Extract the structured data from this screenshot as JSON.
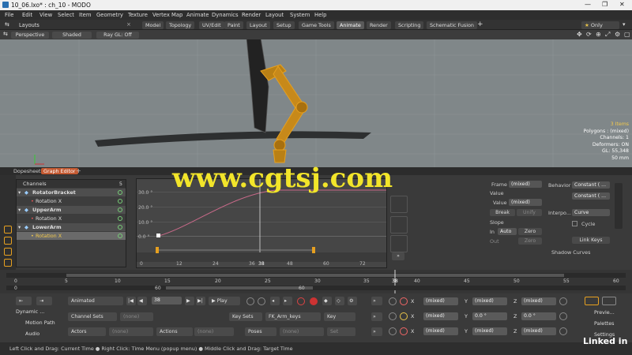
{
  "window": {
    "title": "10_06.lxo* : ch_10 - MODO"
  },
  "menu": [
    "File",
    "Edit",
    "View",
    "Select",
    "Item",
    "Geometry",
    "Texture",
    "Vertex Map",
    "Animate",
    "Dynamics",
    "Render",
    "Layout",
    "System",
    "Help"
  ],
  "layout_label": "Layouts",
  "tabs": [
    "Model",
    "Topology",
    "UV/Edit",
    "Paint",
    "Layout",
    "Setup",
    "Game Tools",
    "Animate",
    "Render",
    "Scripting",
    "Schematic Fusion"
  ],
  "active_tab": "Animate",
  "only_label": "Only",
  "viewport": {
    "view": "Perspective",
    "shading": "Shaded",
    "renderer": "Ray GL: Off"
  },
  "vp_info": [
    "3 Items",
    "Polygons : (mixed)",
    "Channels: 1",
    "Deformers: ON",
    "GL: 55,348",
    "50 mm"
  ],
  "graph_tabs": [
    "Dopesheet",
    "Graph Editor"
  ],
  "channels": {
    "header": "Channels",
    "count": "5",
    "rows": [
      {
        "name": "RotatorBracket",
        "type": "item"
      },
      {
        "name": "Rotation X",
        "type": "channel"
      },
      {
        "name": "UpperArm",
        "type": "item"
      },
      {
        "name": "Rotation X",
        "type": "channel"
      },
      {
        "name": "LowerArm",
        "type": "item"
      },
      {
        "name": "Rotation X",
        "type": "channel-selected"
      }
    ]
  },
  "graph": {
    "y_labels": [
      "30.0 °",
      "20.0 °",
      "10.0 °",
      "0.0 °"
    ],
    "x_labels": [
      "0",
      "12",
      "24",
      "36",
      "48",
      "60",
      "72"
    ],
    "current_frame": "38"
  },
  "props": {
    "frame_label": "Frame",
    "frame_value": "(mixed)",
    "value_section": "Value",
    "value_label": "Value",
    "value_value": "(mixed)",
    "break": "Break",
    "unify": "Unify",
    "slope_section": "Slope",
    "in_label": "In",
    "in_value": "Auto",
    "zero1": "Zero",
    "out_label": "Out",
    "zero2": "Zero"
  },
  "behavior": {
    "behavior_label": "Behavior",
    "behavior_value": "Constant ( ...",
    "behavior_value2": "Constant ( ...",
    "interp_label": "Interpo...",
    "interp_value": "Curve",
    "cycle": "Cycle",
    "link_keys": "Link Keys",
    "shadow_curves": "Shadow Curves"
  },
  "timeline": {
    "top_ticks": [
      "0",
      "5",
      "10",
      "15",
      "20",
      "25",
      "30",
      "35",
      "38",
      "40",
      "45",
      "50",
      "55",
      "60"
    ],
    "bottom_ticks": [
      "0",
      "60",
      "60"
    ]
  },
  "transport": {
    "mode": "Animated",
    "frame": "38",
    "play": "Play",
    "channel_sets": "Channel Sets",
    "channel_sets_value": "(none)",
    "key_sets": "Key Sets",
    "key_sets_value": "FK_Arm_keys",
    "key": "Key",
    "actors": "Actors",
    "actors_value": "(none)",
    "actions": "Actions",
    "actions_value": "(none)",
    "poses": "Poses",
    "poses_value": "(none)",
    "set": "Set"
  },
  "left_tools": [
    "Dynamic ...",
    "Motion Path",
    "Audio"
  ],
  "xform": {
    "row1": [
      "(mixed)",
      "(mixed)",
      "(mixed)"
    ],
    "row2": [
      "(mixed)",
      "0.0 °",
      "0.0 °"
    ],
    "row3": [
      "(mixed)",
      "(mixed)",
      "(mixed)"
    ],
    "axes": [
      "X",
      "Y",
      "Z"
    ]
  },
  "right_tools": [
    "Previe...",
    "Palettes",
    "Settings"
  ],
  "status": "Left Click and Drag: Current Time ● Right Click: Time Menu (popup menu) ● Middle Click and Drag: Target Time",
  "watermark": "www.cgtsj.com",
  "brand": "Linked in"
}
